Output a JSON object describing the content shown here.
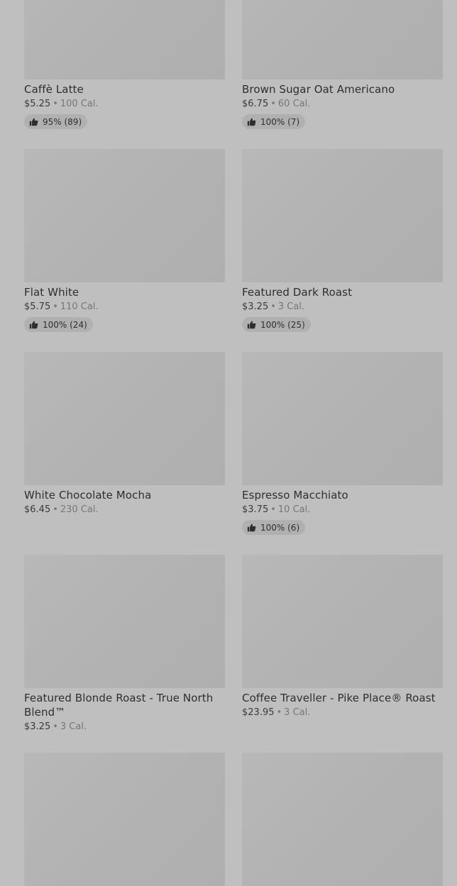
{
  "products": [
    {
      "name": "Caffè Latte",
      "price": "$5.25",
      "calories": "100 Cal.",
      "rating": "95% (89)"
    },
    {
      "name": "Brown Sugar Oat Americano",
      "price": "$6.75",
      "calories": "60 Cal.",
      "rating": "100% (7)"
    },
    {
      "name": "Flat White",
      "price": "$5.75",
      "calories": "110 Cal.",
      "rating": "100% (24)"
    },
    {
      "name": "Featured Dark Roast",
      "price": "$3.25",
      "calories": "3 Cal.",
      "rating": "100% (25)"
    },
    {
      "name": "White Chocolate Mocha",
      "price": "$6.45",
      "calories": "230 Cal.",
      "rating": null
    },
    {
      "name": "Espresso Macchiato",
      "price": "$3.75",
      "calories": "10 Cal.",
      "rating": "100% (6)"
    },
    {
      "name": "Featured Blonde Roast - True North Blend™",
      "price": "$3.25",
      "calories": "3 Cal.",
      "rating": null
    },
    {
      "name": "Coffee Traveller - Pike Place® Roast",
      "price": "$23.95",
      "calories": "3 Cal.",
      "rating": null
    }
  ],
  "separator": "•",
  "icons": {
    "rating": "thumbs-up-icon"
  }
}
